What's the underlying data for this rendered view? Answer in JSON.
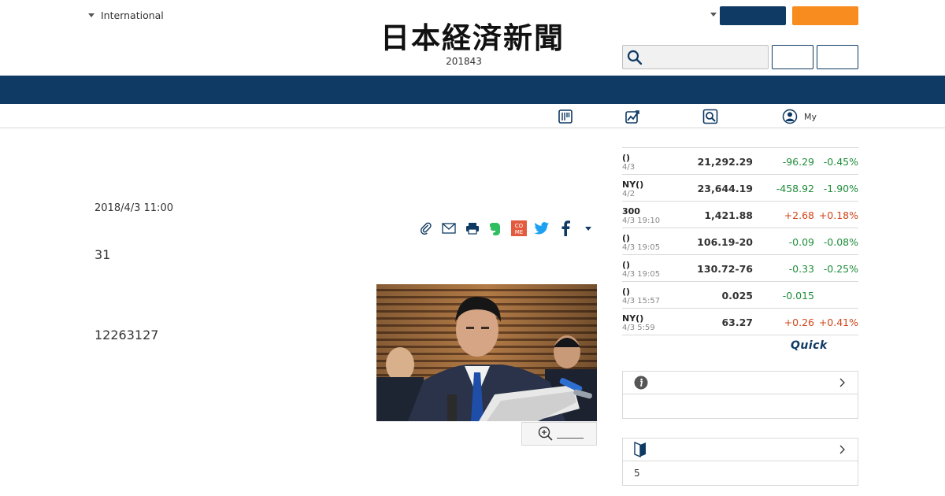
{
  "header": {
    "edition_label": "International",
    "logo_text": "日本経済新聞",
    "logo_subtitle": "201843",
    "navy_button_label": "",
    "orange_button_label": "",
    "search_placeholder": "",
    "login_label": "",
    "register_label": ""
  },
  "subnav": {
    "items": [
      {
        "icon": "newspaper-icon",
        "label": ""
      },
      {
        "icon": "chart-icon",
        "label": ""
      },
      {
        "icon": "search-icon",
        "label": ""
      },
      {
        "icon": "user-icon",
        "label": "My"
      }
    ]
  },
  "article": {
    "date": "2018/4/3 11:00",
    "paragraph1": "31",
    "paragraph2": "12263127",
    "share_icons": [
      "clip-icon",
      "mail-icon",
      "print-icon",
      "evernote-icon",
      "come-icon",
      "twitter-icon",
      "facebook-icon",
      "more-caret-icon"
    ]
  },
  "market": {
    "rows": [
      {
        "name": "()",
        "time": "4/3",
        "value": "21,292.29",
        "change": "-96.29",
        "percent": "-0.45%",
        "dir": "down"
      },
      {
        "name": "NY()",
        "time": "4/2",
        "value": "23,644.19",
        "change": "-458.92",
        "percent": "-1.90%",
        "dir": "down"
      },
      {
        "name": "300",
        "time": "4/3 19:10",
        "value": "1,421.88",
        "change": "+2.68",
        "percent": "+0.18%",
        "dir": "up"
      },
      {
        "name": "()",
        "time": "4/3 19:05",
        "value": "106.19-20",
        "change": "-0.09",
        "percent": "-0.08%",
        "dir": "down"
      },
      {
        "name": "()",
        "time": "4/3 19:05",
        "value": "130.72-76",
        "change": "-0.33",
        "percent": "-0.25%",
        "dir": "down"
      },
      {
        "name": "()",
        "time": "4/3 15:57",
        "value": "0.025",
        "change": "-0.015",
        "percent": "",
        "dir": "down"
      },
      {
        "name": "NY()",
        "time": "4/3 5:59",
        "value": "63.27",
        "change": "+0.26",
        "percent": "+0.41%",
        "dir": "up"
      }
    ],
    "source_logo": "Quick"
  },
  "boxes": {
    "box1": {
      "icon": "info-icon",
      "title": "",
      "body": ""
    },
    "box2": {
      "icon": "beginner-mark-icon",
      "title": "",
      "body": "5"
    }
  },
  "colors": {
    "navy": "#0e3a63",
    "orange": "#f98c1e",
    "down": "#1f8d3a",
    "up": "#d0461b"
  }
}
